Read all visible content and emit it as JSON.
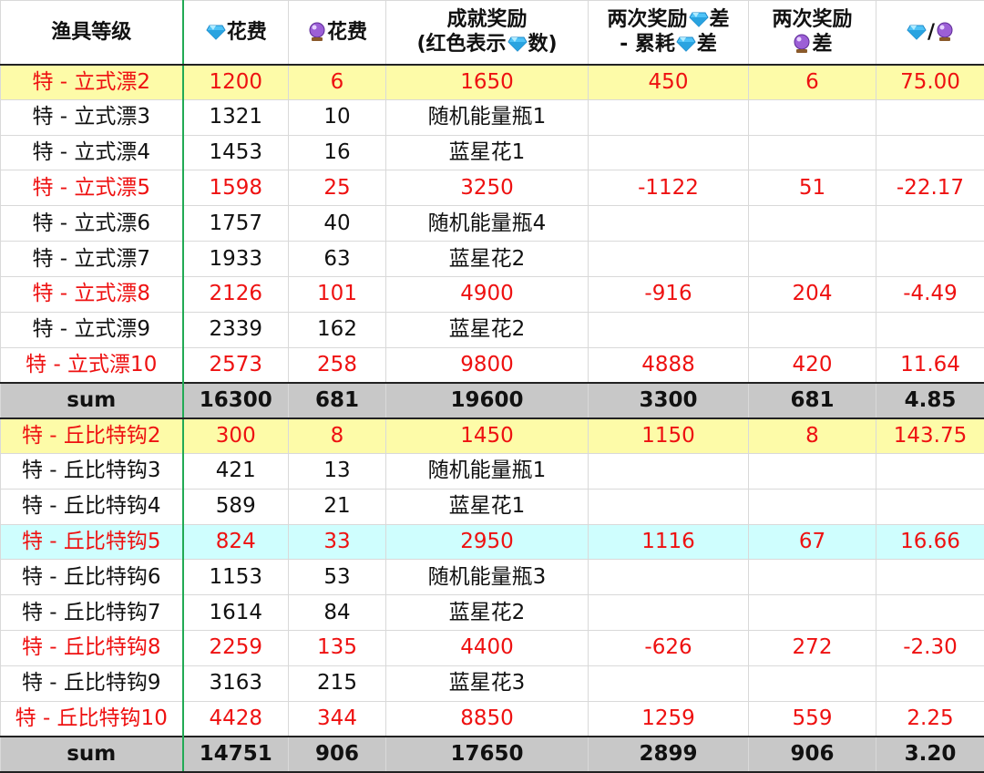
{
  "header": {
    "level": "渔具等级",
    "cost_label": "花费",
    "reward_line1": "成就奖励",
    "reward_line2_a": "(红色表示",
    "reward_line2_b": "数)",
    "diff_line1_a": "两次奖励",
    "diff_line1_b": "差",
    "diff_line2_a": "- 累耗",
    "diff_line2_b": "差",
    "orb_diff_line1": "两次奖励",
    "orb_diff_line2": "差",
    "ratio_sep": "/"
  },
  "icons": {
    "gem": "diamond-gem-icon",
    "orb": "crystal-ball-icon"
  },
  "colors": {
    "red_text": "#ee1111",
    "yellow_row": "#fdfba8",
    "cyan_row": "#cffefe",
    "sum_row": "#c8c8c8",
    "green_line": "#22aa55"
  },
  "rows": [
    {
      "name": "特 - 立式漂2",
      "gem": "1200",
      "orb": "6",
      "reward": "1650",
      "diff": "450",
      "orb_diff": "6",
      "ratio": "75.00",
      "style": "red yellow"
    },
    {
      "name": "特 - 立式漂3",
      "gem": "1321",
      "orb": "10",
      "reward": "随机能量瓶1",
      "diff": "",
      "orb_diff": "",
      "ratio": "",
      "style": ""
    },
    {
      "name": "特 - 立式漂4",
      "gem": "1453",
      "orb": "16",
      "reward": "蓝星花1",
      "diff": "",
      "orb_diff": "",
      "ratio": "",
      "style": ""
    },
    {
      "name": "特 - 立式漂5",
      "gem": "1598",
      "orb": "25",
      "reward": "3250",
      "diff": "-1122",
      "orb_diff": "51",
      "ratio": "-22.17",
      "style": "red"
    },
    {
      "name": "特 - 立式漂6",
      "gem": "1757",
      "orb": "40",
      "reward": "随机能量瓶4",
      "diff": "",
      "orb_diff": "",
      "ratio": "",
      "style": ""
    },
    {
      "name": "特 - 立式漂7",
      "gem": "1933",
      "orb": "63",
      "reward": "蓝星花2",
      "diff": "",
      "orb_diff": "",
      "ratio": "",
      "style": ""
    },
    {
      "name": "特 - 立式漂8",
      "gem": "2126",
      "orb": "101",
      "reward": "4900",
      "diff": "-916",
      "orb_diff": "204",
      "ratio": "-4.49",
      "style": "red"
    },
    {
      "name": "特 - 立式漂9",
      "gem": "2339",
      "orb": "162",
      "reward": "蓝星花2",
      "diff": "",
      "orb_diff": "",
      "ratio": "",
      "style": ""
    },
    {
      "name": "特 - 立式漂10",
      "gem": "2573",
      "orb": "258",
      "reward": "9800",
      "diff": "4888",
      "orb_diff": "420",
      "ratio": "11.64",
      "style": "red"
    },
    {
      "name": "sum",
      "gem": "16300",
      "orb": "681",
      "reward": "19600",
      "diff": "3300",
      "orb_diff": "681",
      "ratio": "4.85",
      "style": "sum"
    },
    {
      "name": "特 - 丘比特钩2",
      "gem": "300",
      "orb": "8",
      "reward": "1450",
      "diff": "1150",
      "orb_diff": "8",
      "ratio": "143.75",
      "style": "red yellow"
    },
    {
      "name": "特 - 丘比特钩3",
      "gem": "421",
      "orb": "13",
      "reward": "随机能量瓶1",
      "diff": "",
      "orb_diff": "",
      "ratio": "",
      "style": ""
    },
    {
      "name": "特 - 丘比特钩4",
      "gem": "589",
      "orb": "21",
      "reward": "蓝星花1",
      "diff": "",
      "orb_diff": "",
      "ratio": "",
      "style": ""
    },
    {
      "name": "特 - 丘比特钩5",
      "gem": "824",
      "orb": "33",
      "reward": "2950",
      "diff": "1116",
      "orb_diff": "67",
      "ratio": "16.66",
      "style": "red cyan"
    },
    {
      "name": "特 - 丘比特钩6",
      "gem": "1153",
      "orb": "53",
      "reward": "随机能量瓶3",
      "diff": "",
      "orb_diff": "",
      "ratio": "",
      "style": ""
    },
    {
      "name": "特 - 丘比特钩7",
      "gem": "1614",
      "orb": "84",
      "reward": "蓝星花2",
      "diff": "",
      "orb_diff": "",
      "ratio": "",
      "style": ""
    },
    {
      "name": "特 - 丘比特钩8",
      "gem": "2259",
      "orb": "135",
      "reward": "4400",
      "diff": "-626",
      "orb_diff": "272",
      "ratio": "-2.30",
      "style": "red"
    },
    {
      "name": "特 - 丘比特钩9",
      "gem": "3163",
      "orb": "215",
      "reward": "蓝星花3",
      "diff": "",
      "orb_diff": "",
      "ratio": "",
      "style": ""
    },
    {
      "name": "特 - 丘比特钩10",
      "gem": "4428",
      "orb": "344",
      "reward": "8850",
      "diff": "1259",
      "orb_diff": "559",
      "ratio": "2.25",
      "style": "red"
    },
    {
      "name": "sum",
      "gem": "14751",
      "orb": "906",
      "reward": "17650",
      "diff": "2899",
      "orb_diff": "906",
      "ratio": "3.20",
      "style": "sum"
    }
  ]
}
